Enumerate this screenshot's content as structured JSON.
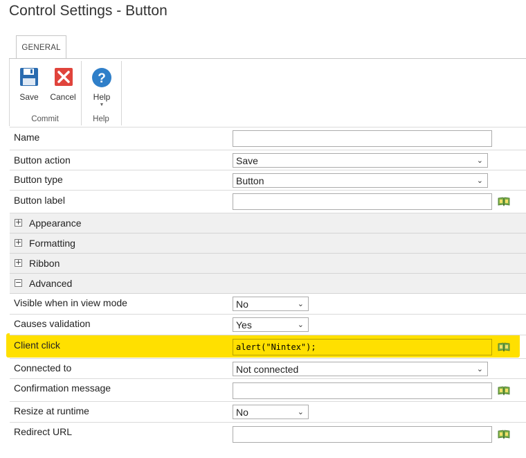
{
  "title": "Control Settings - Button",
  "ribbon": {
    "tab": "GENERAL",
    "save_label": "Save",
    "cancel_label": "Cancel",
    "help_label": "Help",
    "commit_group": "Commit",
    "help_group": "Help"
  },
  "form": {
    "name": {
      "label": "Name",
      "value": ""
    },
    "button_action": {
      "label": "Button action",
      "value": "Save"
    },
    "button_type": {
      "label": "Button type",
      "value": "Button"
    },
    "button_label": {
      "label": "Button label",
      "value": ""
    },
    "sections": {
      "appearance": "Appearance",
      "formatting": "Formatting",
      "ribbon": "Ribbon",
      "advanced": "Advanced"
    },
    "visible_view": {
      "label": "Visible when in view mode",
      "value": "No"
    },
    "causes_validation": {
      "label": "Causes validation",
      "value": "Yes"
    },
    "client_click": {
      "label": "Client click",
      "value": "alert(\"Nintex\");"
    },
    "connected_to": {
      "label": "Connected to",
      "value": "Not connected"
    },
    "confirmation": {
      "label": "Confirmation message",
      "value": ""
    },
    "resize": {
      "label": "Resize at runtime",
      "value": "No"
    },
    "redirect": {
      "label": "Redirect URL",
      "value": ""
    }
  },
  "colors": {
    "highlight": "#ffe000",
    "save_icon": "#2b6cb0",
    "cancel_icon": "#e0443c",
    "help_icon": "#2f7fc9"
  }
}
